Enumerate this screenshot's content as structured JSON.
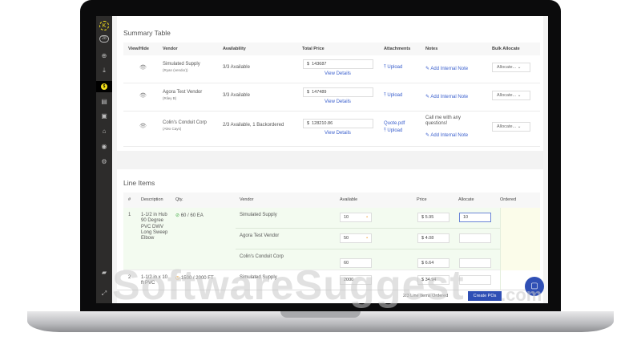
{
  "sidebar": {
    "badge_count": "28",
    "active_badge": "$"
  },
  "summary": {
    "title": "Summary Table",
    "headers": [
      "View/Hide",
      "Vendor",
      "Availability",
      "Total Price",
      "Attachments",
      "Notes",
      "Bulk Allocate"
    ],
    "rows": [
      {
        "vendor": "Simulated Supply",
        "contact": "(Ryan (vendor))",
        "availability": "3/3 Available",
        "price": "143687",
        "view": "View Details",
        "attachment": "",
        "upload": "Upload",
        "note": "",
        "add_note": "Add Internal Note",
        "allocate": "Allocate..."
      },
      {
        "vendor": "Agora Test Vendor",
        "contact": "(Riley B)",
        "availability": "3/3 Available",
        "price": "147489",
        "view": "View Details",
        "attachment": "",
        "upload": "Upload",
        "note": "",
        "add_note": "Add Internal Note",
        "allocate": "Allocate..."
      },
      {
        "vendor": "Colin's Conduit Corp",
        "contact": "(Alex Cays)",
        "availability": "2/3 Available, 1 Backordered",
        "price": "128210.86",
        "view": "View Details",
        "attachment": "Quote.pdf",
        "upload": "Upload",
        "note": "Call me with any questions!",
        "add_note": "Add Internal Note",
        "allocate": "Allocate..."
      }
    ],
    "currency": "$"
  },
  "line_items": {
    "title": "Line Items",
    "headers": [
      "#",
      "Description",
      "Qty.",
      "Vendor",
      "Available",
      "Price",
      "Allocate",
      "Ordered"
    ],
    "items": [
      {
        "num": "1",
        "description": "1-1/2 in Hub 90 Degree PVC DWV Long Sweep Elbow",
        "qty": "60 / 60 EA",
        "vendors": [
          {
            "name": "Simulated Supply",
            "available": "10",
            "price": "$ 5.95",
            "allocate": "10"
          },
          {
            "name": "Agora Test Vendor",
            "available": "50",
            "price": "$ 4.08",
            "allocate": ""
          },
          {
            "name": "Colin's Conduit Corp",
            "available": "60",
            "price": "$ 6.64",
            "allocate": ""
          }
        ]
      },
      {
        "num": "2",
        "description": "1-1/2 in x 10 ft PVC",
        "qty": "1500 / 2000 FT",
        "vendors": [
          {
            "name": "Simulated Supply",
            "available": "2000",
            "price": "$ 34.94",
            "allocate": ""
          }
        ]
      }
    ]
  },
  "footer": {
    "status": "2/3 Line Items Ordered",
    "create_button": "Create POs"
  },
  "watermark": "SoftwareSuggest",
  "watermark_suffix": ".com",
  "colors": {
    "accent": "#2f4fb5",
    "link": "#3a5fcd",
    "row_green": "#f3fbf0",
    "ordered_yellow": "#fbfcea",
    "sidebar": "#2d2c2b",
    "badge": "#f5e11b"
  }
}
